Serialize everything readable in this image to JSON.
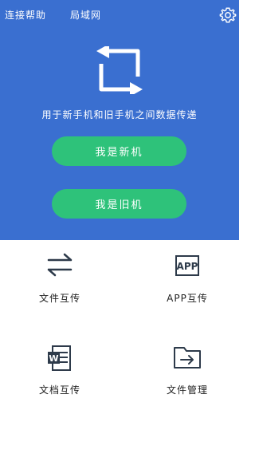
{
  "header": {
    "link_left": "连接帮助",
    "link_right": "局域网",
    "subtitle": "用于新手机和旧手机之间数据传递",
    "primary_button": "我是新机",
    "secondary_button": "我是旧机"
  },
  "features": [
    {
      "label": "文件互传",
      "icon": "swap-arrows-icon"
    },
    {
      "label": "APP互传",
      "icon": "app-icon"
    },
    {
      "label": "文档互传",
      "icon": "word-doc-icon"
    },
    {
      "label": "文件管理",
      "icon": "folder-arrow-icon"
    }
  ],
  "colors": {
    "header_bg": "#3a6fd0",
    "button_green": "#2ec27a",
    "icon_dark": "#2d3a4a"
  }
}
